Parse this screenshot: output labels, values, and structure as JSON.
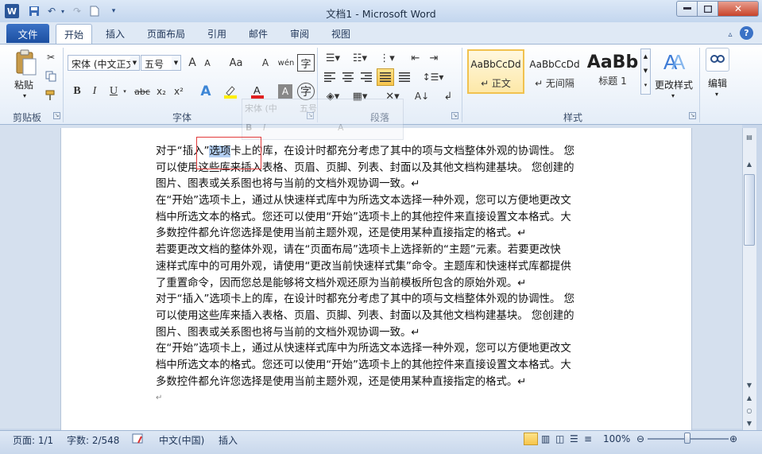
{
  "window": {
    "title": "文档1 - Microsoft Word",
    "app_icon_letter": "W"
  },
  "tabs": {
    "file": "文件",
    "items": [
      "开始",
      "插入",
      "页面布局",
      "引用",
      "邮件",
      "审阅",
      "视图"
    ],
    "active": "开始"
  },
  "ribbon": {
    "clipboard": {
      "label": "剪贴板",
      "paste": "粘贴"
    },
    "font": {
      "label": "字体",
      "font_name": "宋体 (中文正文)",
      "font_size": "五号",
      "bold": "B",
      "italic": "I",
      "underline": "U",
      "strike": "abc",
      "subscript": "x₂",
      "superscript": "x²",
      "grow": "A",
      "shrink": "A",
      "change_case": "Aa",
      "clear": "A",
      "font_color": "A",
      "char_shading": "A",
      "phonetic": "wén"
    },
    "paragraph": {
      "label": "段落"
    },
    "styles": {
      "label": "样式",
      "items": [
        {
          "sample": "AaBbCcDd",
          "name": "↵ 正文"
        },
        {
          "sample": "AaBbCcDd",
          "name": "↵ 无间隔"
        },
        {
          "sample": "AaBb",
          "name": "标题 1"
        }
      ],
      "change_styles": "更改样式"
    },
    "editing": {
      "label": "编辑"
    }
  },
  "mini_toolbar": {
    "font": "宋体 (中",
    "size": "五号"
  },
  "document": {
    "lines": [
      [
        "对于“插入”",
        "选项",
        "卡上的库，在设计时都充分考虑了其中的项与文档整体外观的协调性。 您"
      ],
      [
        "可以使用这些库来插入表格、页眉、页脚、列表、封面以及其他文档构建基块。 您创建的"
      ],
      [
        "图片、图表或关系图也将与当前的文档外观协调一致。↵"
      ],
      [
        "在“开始”选项卡上，通过从快速样式库中为所选文本选择一种外观，您可以方便地更改文"
      ],
      [
        "档中所选文本的格式。您还可以使用“开始”选项卡上的其他控件来直接设置文本格式。大"
      ],
      [
        "多数控件都允许您选择是使用当前主题外观，还是使用某种直接指定的格式。↵"
      ],
      [
        "若要更改文档的整体外观，请在“页面布局”选项卡上选择新的“主题”元素。若要更改快"
      ],
      [
        "速样式库中的可用外观，请使用“更改当前快速样式集”命令。主题库和快速样式库都提供"
      ],
      [
        "了重置命令，因而您总是能够将文档外观还原为当前模板所包含的原始外观。↵"
      ],
      [
        "对于“插入”选项卡上的库，在设计时都充分考虑了其中的项与文档整体外观的协调性。 您"
      ],
      [
        "可以使用这些库来插入表格、页眉、页脚、列表、封面以及其他文档构建基块。 您创建的"
      ],
      [
        "图片、图表或关系图也将与当前的文档外观协调一致。↵"
      ],
      [
        "在“开始”选项卡上，通过从快速样式库中为所选文本选择一种外观，您可以方便地更改文"
      ],
      [
        "档中所选文本的格式。您还可以使用“开始”选项卡上的其他控件来直接设置文本格式。大"
      ],
      [
        "多数控件都允许您选择是使用当前主题外观，还是使用某种直接指定的格式。↵"
      ],
      [
        "↵"
      ]
    ]
  },
  "status": {
    "page": "页面: 1/1",
    "words": "字数: 2/548",
    "language": "中文(中国)",
    "mode": "插入",
    "zoom": "100%",
    "zoom_value_percent": 100
  },
  "colors": {
    "accent": "#2a5699",
    "selection": "#b3cff2",
    "highlight_rect": "#e23a3a"
  }
}
